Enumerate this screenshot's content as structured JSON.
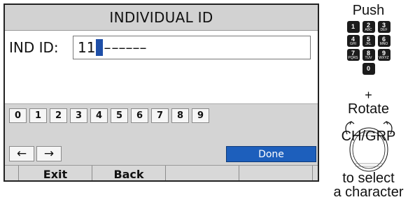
{
  "screen": {
    "title": "INDIVIDUAL ID",
    "id_label": "IND ID:",
    "id_value": "11",
    "id_dash_first": "–",
    "id_dash_tail": "–––––",
    "keypad": [
      "0",
      "1",
      "2",
      "3",
      "4",
      "5",
      "6",
      "7",
      "8",
      "9"
    ],
    "arrow_left": "←",
    "arrow_right": "→",
    "done": "Done",
    "softkeys": [
      "",
      "Exit",
      "Back",
      "",
      "",
      ""
    ]
  },
  "side": {
    "push": "Push",
    "keys": [
      [
        {
          "n": "1",
          "s": ""
        },
        {
          "n": "2",
          "s": "ABC"
        },
        {
          "n": "3",
          "s": "DEF"
        }
      ],
      [
        {
          "n": "4",
          "s": "GHI"
        },
        {
          "n": "5",
          "s": "JKL"
        },
        {
          "n": "6",
          "s": "MNO"
        }
      ],
      [
        {
          "n": "7",
          "s": "PQRS"
        },
        {
          "n": "8",
          "s": "TUV"
        },
        {
          "n": "9",
          "s": "WXYZ"
        }
      ],
      [
        {
          "n": "0",
          "s": ""
        }
      ]
    ],
    "plus": "+",
    "rotate": "Rotate",
    "dial_label": "CH/GRP",
    "to_select": "to select",
    "a_character": "a character"
  },
  "colors": {
    "cursor": "#1e4fa8",
    "done_button": "#1d5fbc",
    "title_bar": "#d2d2d2",
    "keypad_area": "#d4d4d4"
  },
  "icons": {
    "dial": "rotary-dial-icon",
    "arrow_left": "arrow-left-icon",
    "arrow_right": "arrow-right-icon"
  }
}
